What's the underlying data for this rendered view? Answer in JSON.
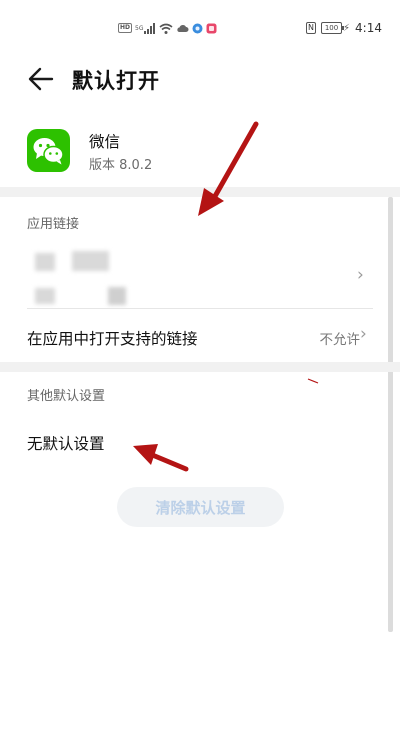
{
  "status_bar": {
    "network_chip": "HD",
    "network_type": "5G",
    "battery": "100",
    "time": "4:14",
    "nfc_label": "N"
  },
  "header": {
    "back_icon": "arrow-left-icon",
    "title": "默认打开"
  },
  "app": {
    "name": "微信",
    "version": "版本 8.0.2",
    "icon": "wechat-icon",
    "icon_color": "#2dc100"
  },
  "app_links": {
    "section_label": "应用链接",
    "open_supported_label": "在应用中打开支持的链接",
    "open_supported_value": "不允许"
  },
  "other_defaults": {
    "section_label": "其他默认设置",
    "status": "无默认设置",
    "clear_button": "清除默认设置"
  },
  "annotation_color": "#b41414"
}
